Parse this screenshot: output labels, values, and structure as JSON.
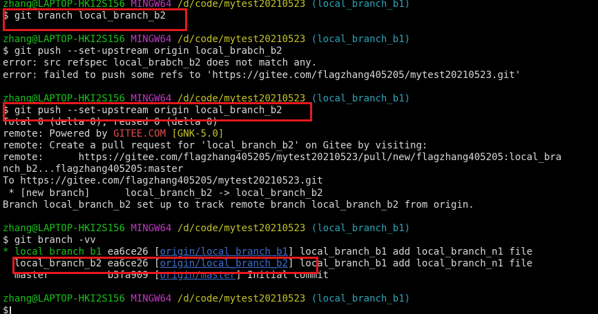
{
  "colors": {
    "background": "#000000",
    "user_host": "#19c21a",
    "shell_name": "#c13ac3",
    "path": "#c4c42a",
    "branch": "#2ea3b7",
    "text": "#d9d9d9",
    "highlight_box": "#e8191c"
  },
  "prompt": {
    "user_host": "zhang@LAPTOP-HKI2S156",
    "shell": "MINGW64",
    "path": "/d/code/mytest20210523",
    "branch_b1": "(local_branch_b1)"
  },
  "lines": {
    "cmd1": "$ git branch local_branch_b2",
    "cmd2": "$ git push --set-upstream origin local_brabch_b2",
    "err1": "error: src refspec local_brabch_b2 does not match any.",
    "err2": "error: failed to push some refs to 'https://gitee.com/flagzhang405205/mytest20210523.git'",
    "cmd3": "$ git push --set-upstream origin local_branch_b2",
    "total": "Total 0 (delta 0), reused 0 (delta 0)",
    "remote1_prefix": "remote: Powered by ",
    "remote1_gitee": "GITEE.COM",
    "remote1_space": " ",
    "remote1_gnk": "[GNK-5.0]",
    "remote2": "remote: Create a pull request for 'local_branch_b2' on Gitee by visiting:",
    "remote3": "remote:      https://gitee.com/flagzhang405205/mytest20210523/pull/new/flagzhang405205:local_bra",
    "remote3_wrap": "nch_b2...flagzhang405205:master",
    "to": "To https://gitee.com/flagzhang405205/mytest20210523.git",
    "newbranch": " * [new branch]      local_branch_b2 -> local_branch_b2",
    "branch_setup": "Branch local_branch_b2 set up to track remote branch local_branch_b2 from origin.",
    "cmd4": "$ git branch -vv",
    "cmd5": "$"
  },
  "branches": [
    {
      "marker": "* ",
      "name": "local_branch_b1",
      "pad": " ",
      "hash": "ea6ce26",
      "upstream": "origin/local_branch_b1",
      "message": "local_branch_b1 add local_branch_n1 file"
    },
    {
      "marker": "  ",
      "name": "local_branch_b2",
      "pad": " ",
      "hash": "ea6ce26",
      "upstream": "origin/local_branch_b2",
      "message": "local_branch_b1 add local_branch_n1 file"
    },
    {
      "marker": "  ",
      "name": "master",
      "pad": "          ",
      "hash": "b5fa909",
      "upstream": "origin/master",
      "message": "Initial commit"
    }
  ]
}
